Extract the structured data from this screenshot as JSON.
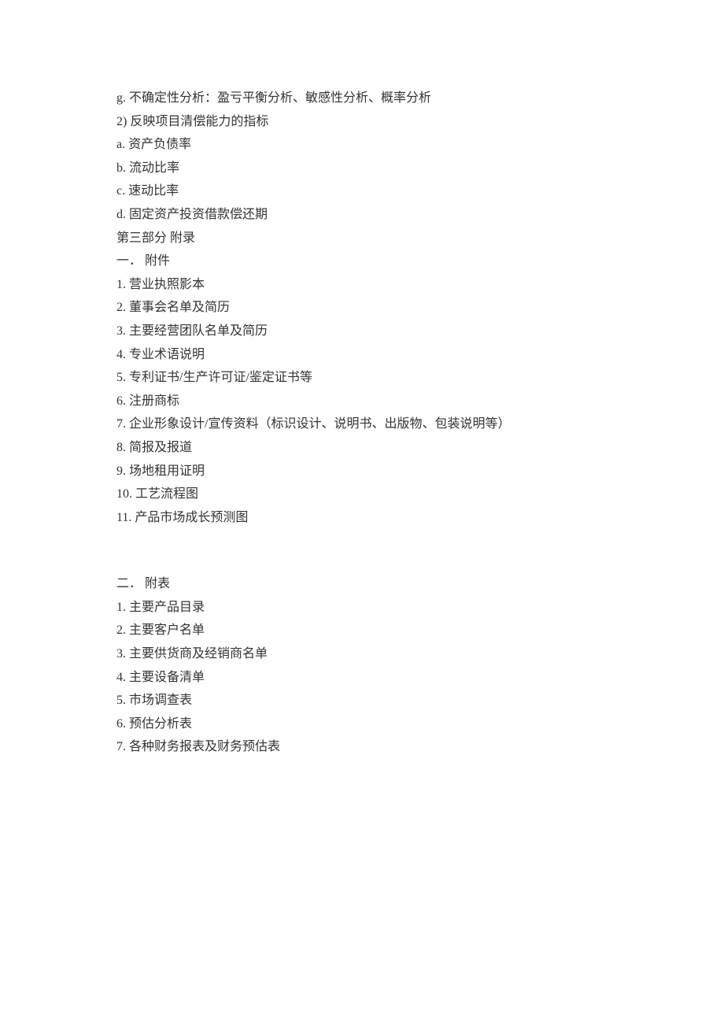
{
  "lines": {
    "l1": "g. 不确定性分析：盈亏平衡分析、敏感性分析、概率分析",
    "l2": "2) 反映项目清偿能力的指标",
    "l3": "a. 资产负债率",
    "l4": "b. 流动比率",
    "l5": "c. 速动比率",
    "l6": "d. 固定资产投资借款偿还期",
    "l7": "第三部分 附录",
    "l8": "一． 附件",
    "l9": "1. 营业执照影本",
    "l10": "2. 董事会名单及简历",
    "l11": "3. 主要经营团队名单及简历",
    "l12": "4. 专业术语说明",
    "l13": "5. 专利证书/生产许可证/鉴定证书等",
    "l14": "6. 注册商标",
    "l15": "7. 企业形象设计/宣传资料（标识设计、说明书、出版物、包装说明等）",
    "l16": "8. 简报及报道",
    "l17": "9. 场地租用证明",
    "l18": "10. 工艺流程图",
    "l19": "11. 产品市场成长预测图",
    "l20": "二． 附表",
    "l21": "1. 主要产品目录",
    "l22": "2. 主要客户名单",
    "l23": "3. 主要供货商及经销商名单",
    "l24": "4. 主要设备清单",
    "l25": "5. 市场调查表",
    "l26": "6. 预估分析表",
    "l27": "7. 各种财务报表及财务预估表"
  }
}
